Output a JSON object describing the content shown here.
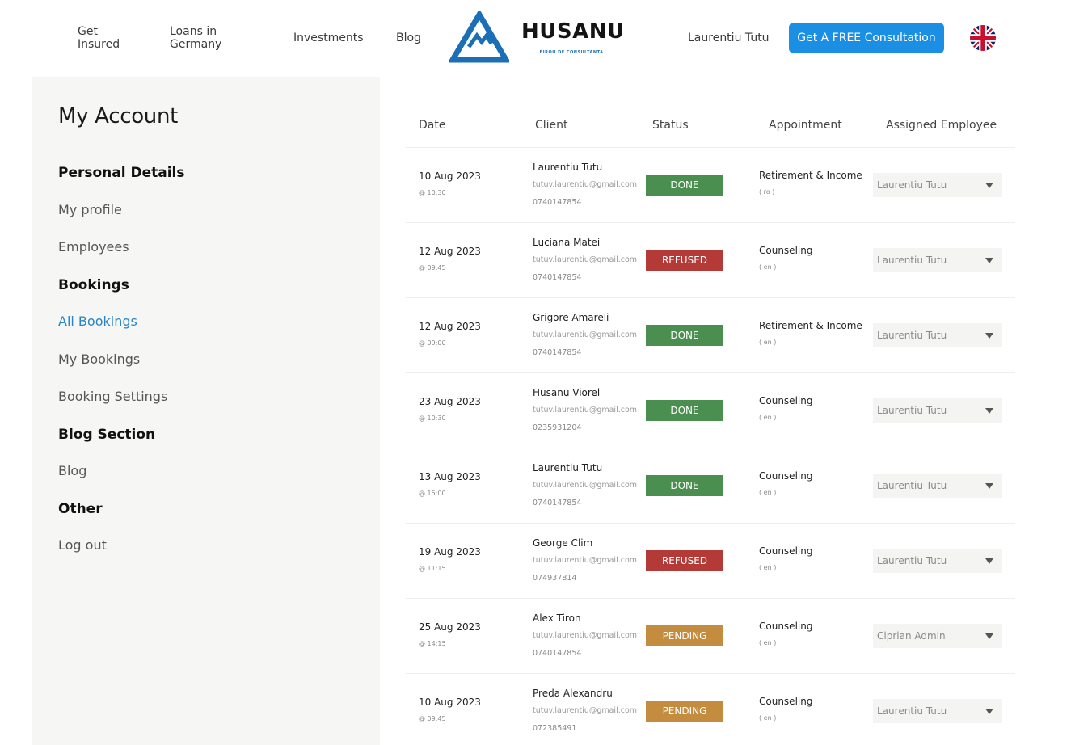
{
  "header": {
    "nav": [
      "Get Insured",
      "Loans in Germany",
      "Investments",
      "Blog"
    ],
    "logo_text": "HUSANU",
    "logo_sub": "BIROU DE CONSULTANTA",
    "user_name": "Laurentiu Tutu",
    "cta_label": "Get A FREE Consultation",
    "language_icon": "uk-flag-icon"
  },
  "sidebar": {
    "title": "My Account",
    "sections": {
      "personal": "Personal Details",
      "bookings": "Bookings",
      "blog": "Blog Section",
      "other": "Other"
    },
    "items": {
      "my_profile": "My profile",
      "employees": "Employees",
      "all_bookings": "All Bookings",
      "my_bookings": "My Bookings",
      "booking_settings": "Booking Settings",
      "blog": "Blog",
      "log_out": "Log out"
    },
    "active_color": "#2a84c6"
  },
  "table": {
    "headers": [
      "Date",
      "Client",
      "Status",
      "Appointment",
      "Assigned Employee"
    ],
    "rows": [
      {
        "date": "10 Aug 2023",
        "time": "@ 10:30",
        "name": "Laurentiu Tutu",
        "email": "tutuv.laurentiu@gmail.com",
        "phone": "0740147854",
        "status": "DONE",
        "appointment": "Retirement & Income",
        "lang": "( ro )",
        "employee": "Laurentiu Tutu"
      },
      {
        "date": "12 Aug 2023",
        "time": "@ 09:45",
        "name": "Luciana Matei",
        "email": "tutuv.laurentiu@gmail.com",
        "phone": "0740147854",
        "status": "REFUSED",
        "appointment": "Counseling",
        "lang": "( en )",
        "employee": "Laurentiu Tutu"
      },
      {
        "date": "12 Aug 2023",
        "time": "@ 09:00",
        "name": "Grigore Amareli",
        "email": "tutuv.laurentiu@gmail.com",
        "phone": "0740147854",
        "status": "DONE",
        "appointment": "Retirement & Income",
        "lang": "( en )",
        "employee": "Laurentiu Tutu"
      },
      {
        "date": "23 Aug 2023",
        "time": "@ 10:30",
        "name": "Husanu Viorel",
        "email": "tutuv.laurentiu@gmail.com",
        "phone": "0235931204",
        "status": "DONE",
        "appointment": "Counseling",
        "lang": "( en )",
        "employee": "Laurentiu Tutu"
      },
      {
        "date": "13 Aug 2023",
        "time": "@ 15:00",
        "name": "Laurentiu Tutu",
        "email": "tutuv.laurentiu@gmail.com",
        "phone": "0740147854",
        "status": "DONE",
        "appointment": "Counseling",
        "lang": "( en )",
        "employee": "Laurentiu Tutu"
      },
      {
        "date": "19 Aug 2023",
        "time": "@ 11:15",
        "name": "George Clim",
        "email": "tutuv.laurentiu@gmail.com",
        "phone": "074937814",
        "status": "REFUSED",
        "appointment": "Counseling",
        "lang": "( en )",
        "employee": "Laurentiu Tutu"
      },
      {
        "date": "25 Aug 2023",
        "time": "@ 14:15",
        "name": "Alex Tiron",
        "email": "tutuv.laurentiu@gmail.com",
        "phone": "0740147854",
        "status": "PENDING",
        "appointment": "Counseling",
        "lang": "( en )",
        "employee": "Ciprian Admin"
      },
      {
        "date": "10 Aug 2023",
        "time": "@ 09:45",
        "name": "Preda Alexandru",
        "email": "tutuv.laurentiu@gmail.com",
        "phone": "072385491",
        "status": "PENDING",
        "appointment": "Counseling",
        "lang": "( en )",
        "employee": "Laurentiu Tutu"
      }
    ],
    "status_colors": {
      "DONE": "#4a8f4f",
      "REFUSED": "#b33a37",
      "PENDING": "#c38c3f"
    }
  }
}
